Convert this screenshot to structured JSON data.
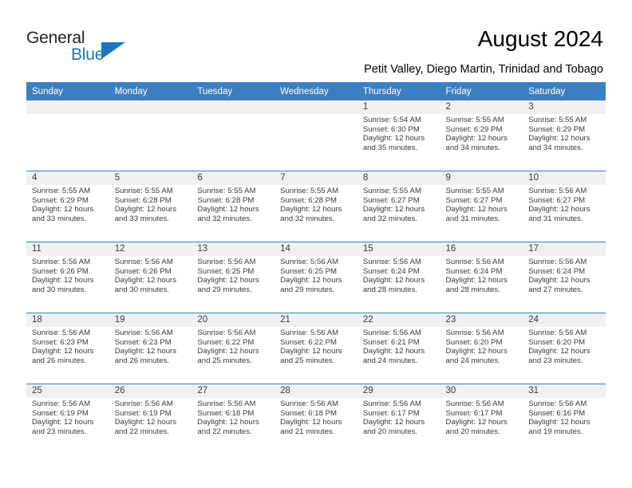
{
  "logo": {
    "text_top": "General",
    "text_bottom": "Blue",
    "accent_color": "#1b75bb"
  },
  "header": {
    "title": "August 2024",
    "subtitle": "Petit Valley, Diego Martin, Trinidad and Tobago"
  },
  "theme": {
    "header_blue": "#3c7fc1",
    "daynum_band": "#f0f0f0",
    "text": "#3a3a3a"
  },
  "calendar": {
    "weekday_headers": [
      "Sunday",
      "Monday",
      "Tuesday",
      "Wednesday",
      "Thursday",
      "Friday",
      "Saturday"
    ],
    "labels": {
      "sunrise": "Sunrise:",
      "sunset": "Sunset:",
      "daylight": "Daylight:"
    },
    "weeks": [
      [
        {
          "day": "",
          "empty": true
        },
        {
          "day": "",
          "empty": true
        },
        {
          "day": "",
          "empty": true
        },
        {
          "day": "",
          "empty": true
        },
        {
          "day": "1",
          "sunrise": "Sunrise: 5:54 AM",
          "sunset": "Sunset: 6:30 PM",
          "daylight": "Daylight: 12 hours and 35 minutes."
        },
        {
          "day": "2",
          "sunrise": "Sunrise: 5:55 AM",
          "sunset": "Sunset: 6:29 PM",
          "daylight": "Daylight: 12 hours and 34 minutes."
        },
        {
          "day": "3",
          "sunrise": "Sunrise: 5:55 AM",
          "sunset": "Sunset: 6:29 PM",
          "daylight": "Daylight: 12 hours and 34 minutes."
        }
      ],
      [
        {
          "day": "4",
          "sunrise": "Sunrise: 5:55 AM",
          "sunset": "Sunset: 6:29 PM",
          "daylight": "Daylight: 12 hours and 33 minutes."
        },
        {
          "day": "5",
          "sunrise": "Sunrise: 5:55 AM",
          "sunset": "Sunset: 6:28 PM",
          "daylight": "Daylight: 12 hours and 33 minutes."
        },
        {
          "day": "6",
          "sunrise": "Sunrise: 5:55 AM",
          "sunset": "Sunset: 6:28 PM",
          "daylight": "Daylight: 12 hours and 32 minutes."
        },
        {
          "day": "7",
          "sunrise": "Sunrise: 5:55 AM",
          "sunset": "Sunset: 6:28 PM",
          "daylight": "Daylight: 12 hours and 32 minutes."
        },
        {
          "day": "8",
          "sunrise": "Sunrise: 5:55 AM",
          "sunset": "Sunset: 6:27 PM",
          "daylight": "Daylight: 12 hours and 32 minutes."
        },
        {
          "day": "9",
          "sunrise": "Sunrise: 5:55 AM",
          "sunset": "Sunset: 6:27 PM",
          "daylight": "Daylight: 12 hours and 31 minutes."
        },
        {
          "day": "10",
          "sunrise": "Sunrise: 5:56 AM",
          "sunset": "Sunset: 6:27 PM",
          "daylight": "Daylight: 12 hours and 31 minutes."
        }
      ],
      [
        {
          "day": "11",
          "sunrise": "Sunrise: 5:56 AM",
          "sunset": "Sunset: 6:26 PM",
          "daylight": "Daylight: 12 hours and 30 minutes."
        },
        {
          "day": "12",
          "sunrise": "Sunrise: 5:56 AM",
          "sunset": "Sunset: 6:26 PM",
          "daylight": "Daylight: 12 hours and 30 minutes."
        },
        {
          "day": "13",
          "sunrise": "Sunrise: 5:56 AM",
          "sunset": "Sunset: 6:25 PM",
          "daylight": "Daylight: 12 hours and 29 minutes."
        },
        {
          "day": "14",
          "sunrise": "Sunrise: 5:56 AM",
          "sunset": "Sunset: 6:25 PM",
          "daylight": "Daylight: 12 hours and 29 minutes."
        },
        {
          "day": "15",
          "sunrise": "Sunrise: 5:56 AM",
          "sunset": "Sunset: 6:24 PM",
          "daylight": "Daylight: 12 hours and 28 minutes."
        },
        {
          "day": "16",
          "sunrise": "Sunrise: 5:56 AM",
          "sunset": "Sunset: 6:24 PM",
          "daylight": "Daylight: 12 hours and 28 minutes."
        },
        {
          "day": "17",
          "sunrise": "Sunrise: 5:56 AM",
          "sunset": "Sunset: 6:24 PM",
          "daylight": "Daylight: 12 hours and 27 minutes."
        }
      ],
      [
        {
          "day": "18",
          "sunrise": "Sunrise: 5:56 AM",
          "sunset": "Sunset: 6:23 PM",
          "daylight": "Daylight: 12 hours and 26 minutes."
        },
        {
          "day": "19",
          "sunrise": "Sunrise: 5:56 AM",
          "sunset": "Sunset: 6:23 PM",
          "daylight": "Daylight: 12 hours and 26 minutes."
        },
        {
          "day": "20",
          "sunrise": "Sunrise: 5:56 AM",
          "sunset": "Sunset: 6:22 PM",
          "daylight": "Daylight: 12 hours and 25 minutes."
        },
        {
          "day": "21",
          "sunrise": "Sunrise: 5:56 AM",
          "sunset": "Sunset: 6:22 PM",
          "daylight": "Daylight: 12 hours and 25 minutes."
        },
        {
          "day": "22",
          "sunrise": "Sunrise: 5:56 AM",
          "sunset": "Sunset: 6:21 PM",
          "daylight": "Daylight: 12 hours and 24 minutes."
        },
        {
          "day": "23",
          "sunrise": "Sunrise: 5:56 AM",
          "sunset": "Sunset: 6:20 PM",
          "daylight": "Daylight: 12 hours and 24 minutes."
        },
        {
          "day": "24",
          "sunrise": "Sunrise: 5:56 AM",
          "sunset": "Sunset: 6:20 PM",
          "daylight": "Daylight: 12 hours and 23 minutes."
        }
      ],
      [
        {
          "day": "25",
          "sunrise": "Sunrise: 5:56 AM",
          "sunset": "Sunset: 6:19 PM",
          "daylight": "Daylight: 12 hours and 23 minutes."
        },
        {
          "day": "26",
          "sunrise": "Sunrise: 5:56 AM",
          "sunset": "Sunset: 6:19 PM",
          "daylight": "Daylight: 12 hours and 22 minutes."
        },
        {
          "day": "27",
          "sunrise": "Sunrise: 5:56 AM",
          "sunset": "Sunset: 6:18 PM",
          "daylight": "Daylight: 12 hours and 22 minutes."
        },
        {
          "day": "28",
          "sunrise": "Sunrise: 5:56 AM",
          "sunset": "Sunset: 6:18 PM",
          "daylight": "Daylight: 12 hours and 21 minutes."
        },
        {
          "day": "29",
          "sunrise": "Sunrise: 5:56 AM",
          "sunset": "Sunset: 6:17 PM",
          "daylight": "Daylight: 12 hours and 20 minutes."
        },
        {
          "day": "30",
          "sunrise": "Sunrise: 5:56 AM",
          "sunset": "Sunset: 6:17 PM",
          "daylight": "Daylight: 12 hours and 20 minutes."
        },
        {
          "day": "31",
          "sunrise": "Sunrise: 5:56 AM",
          "sunset": "Sunset: 6:16 PM",
          "daylight": "Daylight: 12 hours and 19 minutes."
        }
      ]
    ]
  }
}
